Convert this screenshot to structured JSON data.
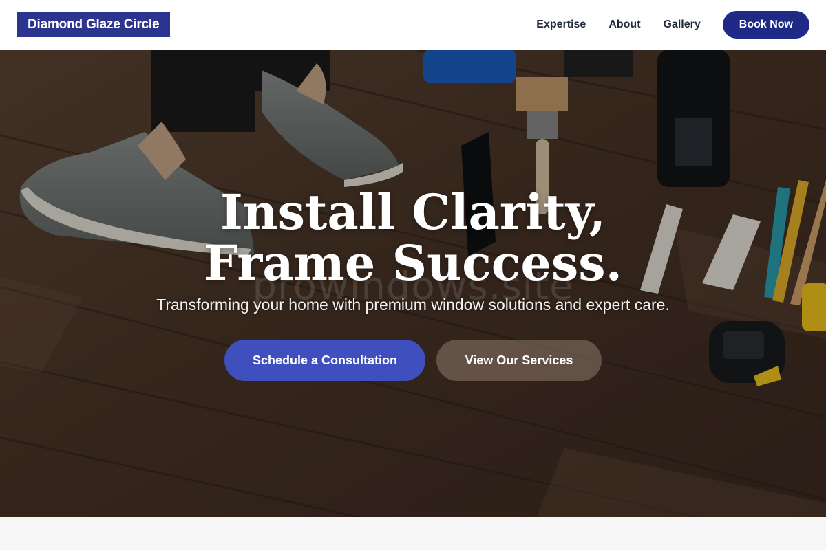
{
  "header": {
    "brand": "Diamond Glaze Circle",
    "nav": [
      "Expertise",
      "About",
      "Gallery"
    ],
    "cta": "Book Now"
  },
  "hero": {
    "title_line1": "Install Clarity,",
    "title_line2": "Frame Success.",
    "subtitle": "Transforming your home with premium window solutions and expert care.",
    "primary_cta": "Schedule a Consultation",
    "secondary_cta": "View Our Services",
    "watermark": "prowindows.site",
    "background_image": "wooden-floor-with-sneakers-and-paint-tools"
  },
  "colors": {
    "brand": "#2b3590",
    "book_button": "#1e2a86",
    "primary_cta": "#3f4fbd",
    "nav_text": "#1f2937"
  }
}
